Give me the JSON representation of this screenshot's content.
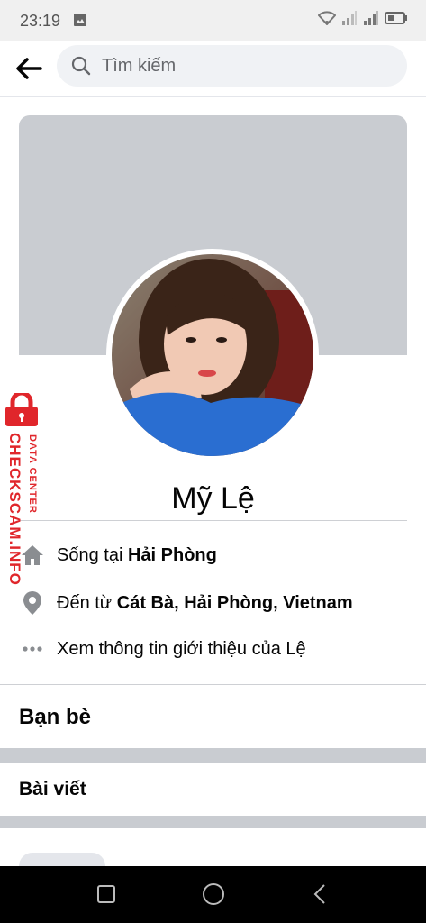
{
  "status_bar": {
    "time": "23:19"
  },
  "search": {
    "placeholder": "Tìm kiếm"
  },
  "profile": {
    "name": "Mỹ Lệ",
    "lives_in_prefix": "Sống tại ",
    "lives_in_city": "Hải Phòng",
    "from_prefix": "Đến từ ",
    "from_place": "Cát Bà, Hải Phòng, Vietnam",
    "about_link": "Xem thông tin giới thiệu của Lệ"
  },
  "sections": {
    "friends": "Bạn bè",
    "posts": "Bài viết"
  },
  "watermark": {
    "line1": "DATA CENTER",
    "line2": "CHECKSCAM.INFO"
  },
  "colors": {
    "cover": "#c9ccd1",
    "watermark_red": "#e0262b",
    "search_bg": "#f0f2f5"
  },
  "icons": [
    "image-icon",
    "wifi-icon",
    "signal-icon",
    "battery-icon",
    "back-arrow-icon",
    "search-icon",
    "home-icon",
    "location-pin-icon",
    "more-dots-icon",
    "lock-icon",
    "recents-icon",
    "home-circle-icon",
    "back-triangle-icon"
  ]
}
